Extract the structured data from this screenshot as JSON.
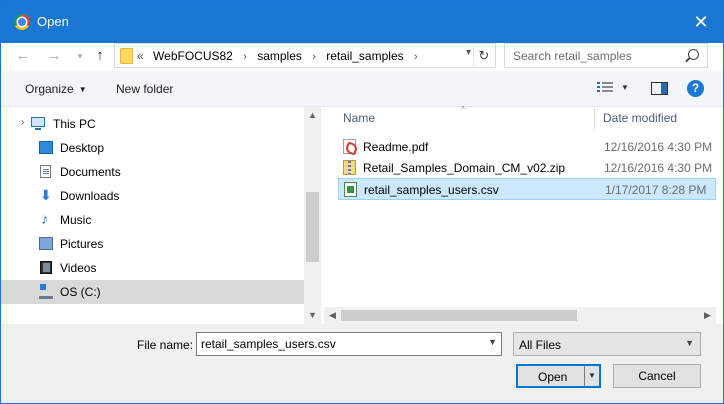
{
  "window": {
    "title": "Open"
  },
  "address": {
    "path_prefix": "«",
    "crumbs": [
      "WebFOCUS82",
      "samples",
      "retail_samples"
    ],
    "search_placeholder": "Search retail_samples"
  },
  "toolbar": {
    "organize_label": "Organize",
    "new_folder_label": "New folder",
    "help_label": "?"
  },
  "nav": {
    "items": [
      {
        "label": "This PC",
        "icon": "computer-icon"
      },
      {
        "label": "Desktop",
        "icon": "desktop-icon"
      },
      {
        "label": "Documents",
        "icon": "documents-icon"
      },
      {
        "label": "Downloads",
        "icon": "downloads-icon"
      },
      {
        "label": "Music",
        "icon": "music-icon"
      },
      {
        "label": "Pictures",
        "icon": "pictures-icon"
      },
      {
        "label": "Videos",
        "icon": "videos-icon"
      },
      {
        "label": "OS (C:)",
        "icon": "drive-icon"
      }
    ],
    "selected": "OS (C:)"
  },
  "files": {
    "columns": {
      "name": "Name",
      "date": "Date modified"
    },
    "rows": [
      {
        "name": "Readme.pdf",
        "date": "12/16/2016 4:30 PM",
        "icon": "pdf-file-icon"
      },
      {
        "name": "Retail_Samples_Domain_CM_v02.zip",
        "date": "12/16/2016 4:30 PM",
        "icon": "zip-file-icon"
      },
      {
        "name": "retail_samples_users.csv",
        "date": "1/17/2017 8:28 PM",
        "icon": "csv-file-icon"
      }
    ],
    "selected": "retail_samples_users.csv"
  },
  "bottom": {
    "file_name_label": "File name:",
    "file_name_value": "retail_samples_users.csv",
    "file_type_value": "All Files",
    "open_label": "Open",
    "cancel_label": "Cancel"
  },
  "colors": {
    "titlebar": "#1a78d4",
    "selection": "#cce8ff",
    "accent": "#0078d7"
  }
}
